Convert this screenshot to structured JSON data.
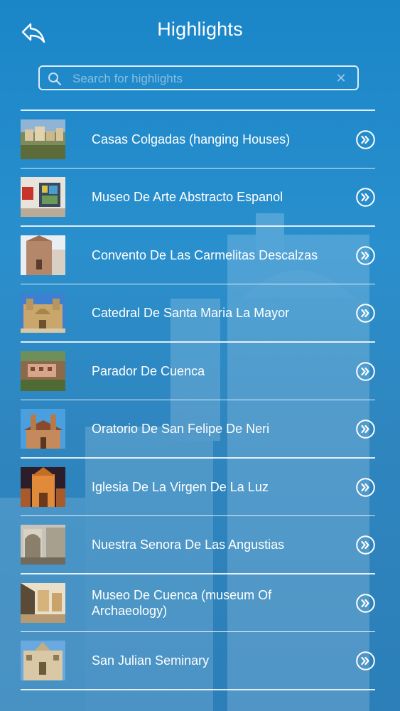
{
  "header": {
    "title": "Highlights"
  },
  "search": {
    "placeholder": "Search for highlights"
  },
  "items": [
    {
      "label": "Casas Colgadas (hanging Houses)"
    },
    {
      "label": "Museo De Arte Abstracto Espanol"
    },
    {
      "label": "Convento De Las Carmelitas Descalzas"
    },
    {
      "label": "Catedral De Santa Maria La Mayor"
    },
    {
      "label": "Parador De Cuenca"
    },
    {
      "label": "Oratorio De San Felipe De Neri"
    },
    {
      "label": "Iglesia De La Virgen De La Luz"
    },
    {
      "label": "Nuestra Senora De Las Angustias"
    },
    {
      "label": "Museo De Cuenca (museum Of Archaeology)"
    },
    {
      "label": "San Julian Seminary"
    }
  ],
  "colors": {
    "background": "#1a86c8",
    "text": "#ffffff"
  }
}
